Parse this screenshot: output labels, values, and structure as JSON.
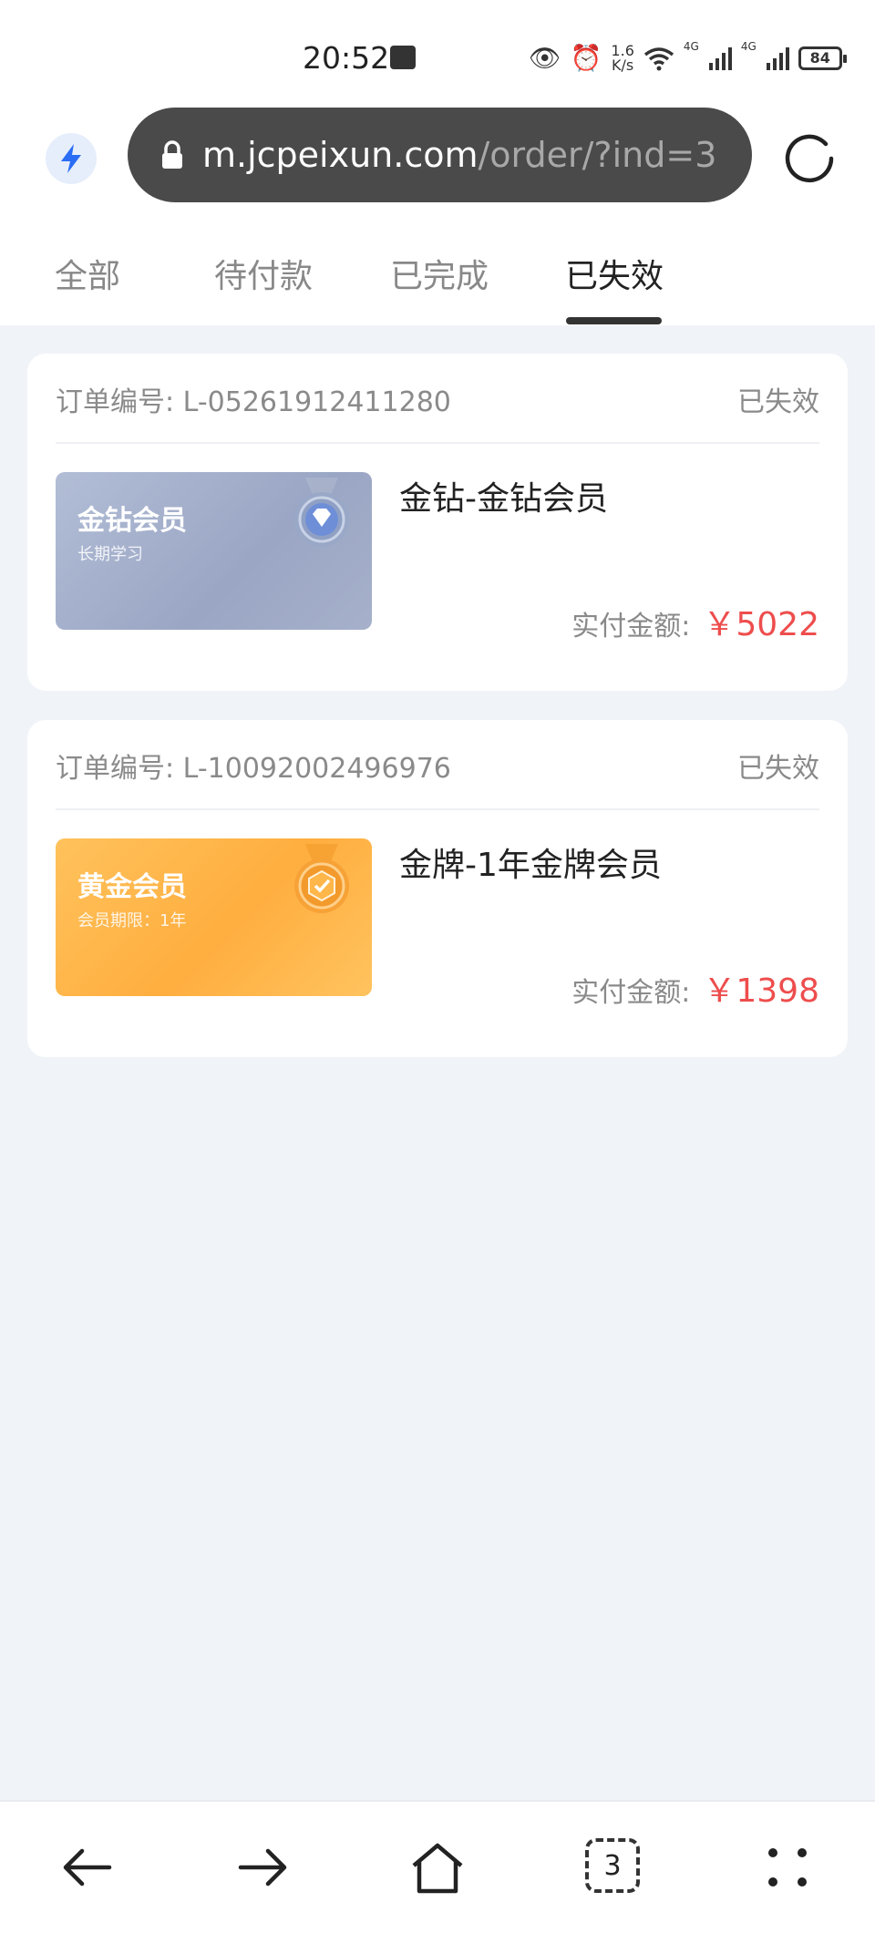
{
  "status_bar": {
    "time": "20:52",
    "net_speed_value": "1.6",
    "net_speed_unit": "K/s",
    "signal_1": "4G",
    "signal_2": "4G",
    "battery": "84"
  },
  "browser": {
    "url_host": "m.jcpeixun.com",
    "url_path": "/order/?ind=3",
    "tab_count": "3",
    "icons": [
      "bolt-icon",
      "lock-icon",
      "reload-icon",
      "back-arrow-icon",
      "forward-arrow-icon",
      "home-icon",
      "tabs-icon",
      "menu-dots-icon"
    ]
  },
  "tabs": [
    {
      "label": "全部"
    },
    {
      "label": "待付款"
    },
    {
      "label": "已完成"
    },
    {
      "label": "已失效"
    }
  ],
  "active_tab": "已失效",
  "orders": [
    {
      "order_label": "订单编号: L-05261912411280",
      "status": "已失效",
      "thumb_title": "金钻会员",
      "thumb_sub": "长期学习",
      "product_name": "金钻-金钻会员",
      "price_label": "实付金额:",
      "price": "￥5022"
    },
    {
      "order_label": "订单编号: L-10092002496976",
      "status": "已失效",
      "thumb_title": "黄金会员",
      "thumb_sub": "会员期限：1年",
      "product_name": "金牌-1年金牌会员",
      "price_label": "实付金额:",
      "price": "￥1398"
    }
  ],
  "colors": {
    "accent_price": "#ee4d4d",
    "background": "#f0f3f7",
    "url_bar": "#4a4a4a"
  }
}
